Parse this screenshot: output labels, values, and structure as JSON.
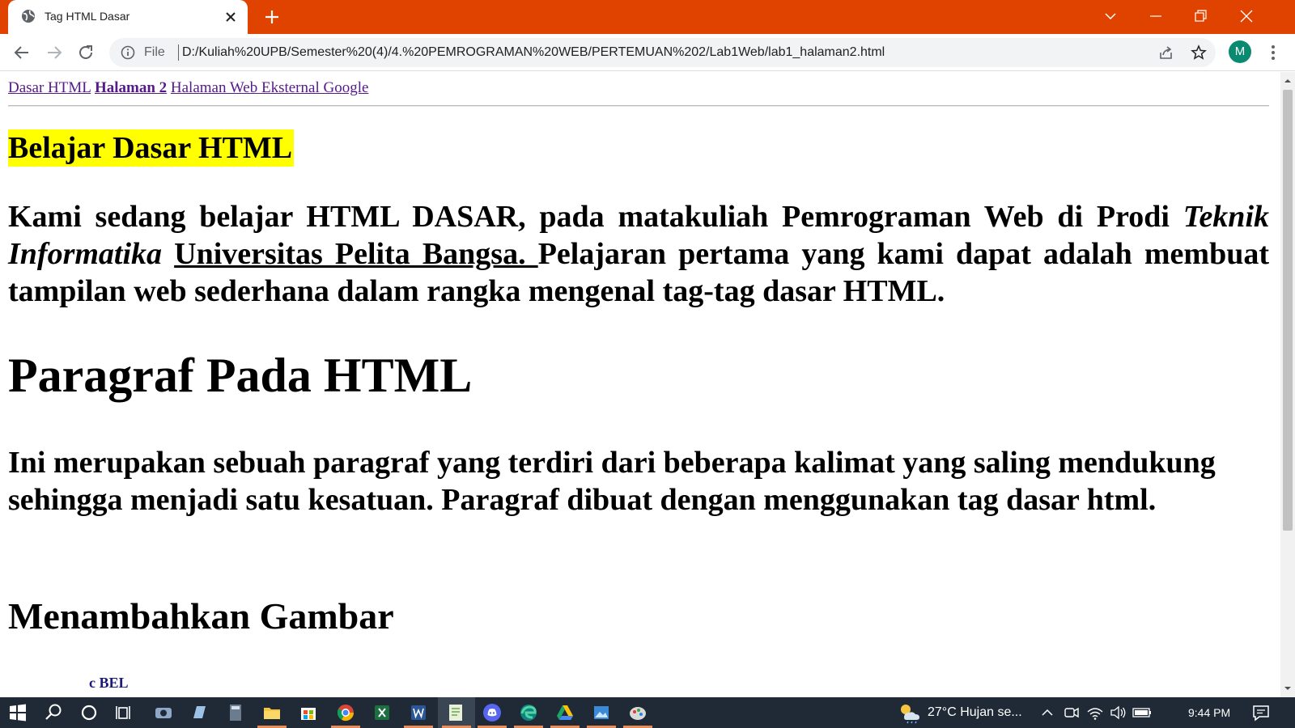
{
  "browser": {
    "tab_title": "Tag HTML Dasar",
    "url_scheme": "File",
    "url": "D:/Kuliah%20UPB/Semester%20(4)/4.%20PEMROGRAMAN%20WEB/PERTEMUAN%202/Lab1Web/lab1_halaman2.html",
    "profile_initial": "M",
    "accent_color": "#e04300"
  },
  "page": {
    "nav": {
      "link1": "Dasar HTML",
      "link2": "Halaman 2",
      "link3": "Halaman Web Eksternal Google"
    },
    "heading_highlight": "Belajar Dasar HTML",
    "intro": {
      "text_before": "Kami sedang belajar HTML DASAR, pada matakuliah Pemrograman Web di Prodi ",
      "italic": "Teknik Informatika",
      "underlined": "Universitas Pelita Bangsa. ",
      "text_after": "Pelajaran pertama yang kami dapat adalah membuat tampilan web sederhana dalam rangka mengenal tag-tag dasar HTML."
    },
    "heading_paragraf": "Paragraf Pada HTML",
    "paragraph": "Ini merupakan sebuah paragraf yang terdiri dari beberapa kalimat yang saling mendukung sehingga menjadi satu kesatuan. Paragraf dibuat dengan menggunakan tag dasar html.",
    "heading_gambar": "Menambahkan Gambar",
    "image_fragment": "c BEL"
  },
  "taskbar": {
    "weather": "27°C  Hujan se...",
    "time": "9:44 PM"
  }
}
